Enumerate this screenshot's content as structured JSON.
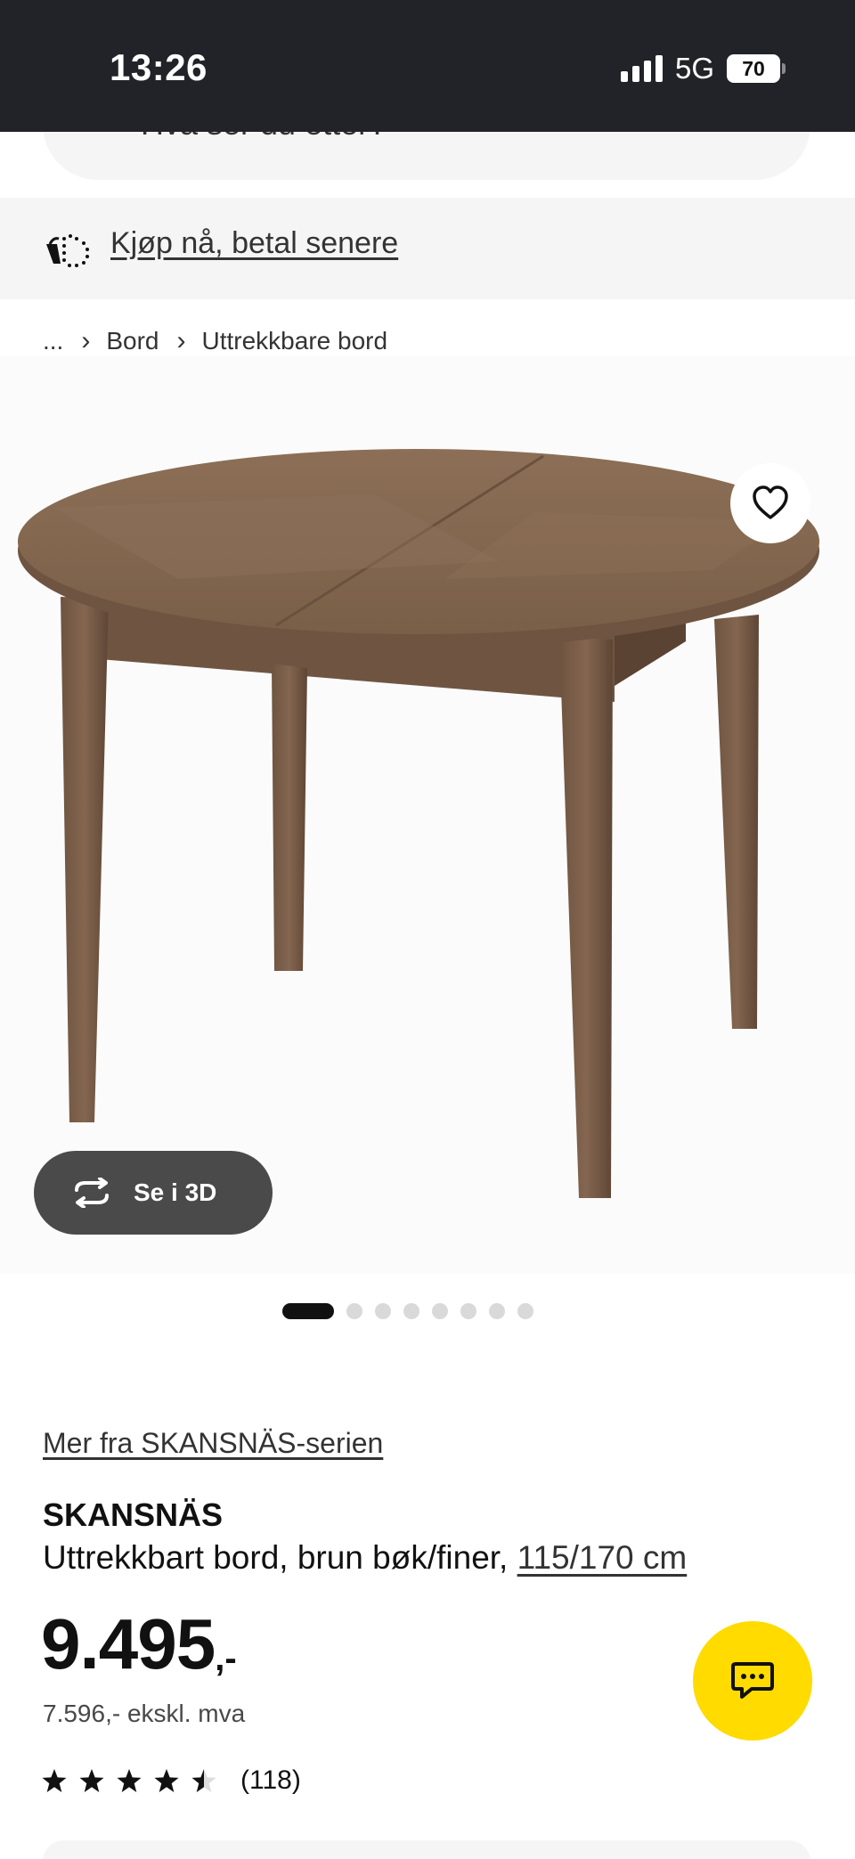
{
  "status_bar": {
    "time": "13:26",
    "network": "5G",
    "battery": "70"
  },
  "search": {
    "placeholder": "Hva ser du etter?",
    "icon": "search-icon"
  },
  "promo": {
    "text": "Kjøp nå, betal senere",
    "icon": "cart-icon"
  },
  "breadcrumb": {
    "ellipsis": "...",
    "items": [
      "Bord",
      "Uttrekkbare bord"
    ]
  },
  "gallery": {
    "button_3d_label": "Se i 3D",
    "image_count": 8,
    "active_index": 0,
    "favorite_icon": "heart-icon"
  },
  "product": {
    "series_link": "Mer fra SKANSNÄS-serien",
    "name": "SKANSNÄS",
    "description": "Uttrekkbart bord, brun bøk/finer,",
    "size": "115/170 cm",
    "price": "9.495",
    "price_suffix": ",-",
    "price_ex_vat": "7.596,- ekskl. mva",
    "rating": 4.5,
    "rating_max": 5,
    "review_count": "(118)"
  },
  "chat": {
    "icon": "chat-icon"
  },
  "colors": {
    "status_bar": "#222328",
    "accent_yellow": "#ffdb00",
    "button_3d": "#4a4a4a",
    "panel_gray": "#f5f5f5"
  }
}
